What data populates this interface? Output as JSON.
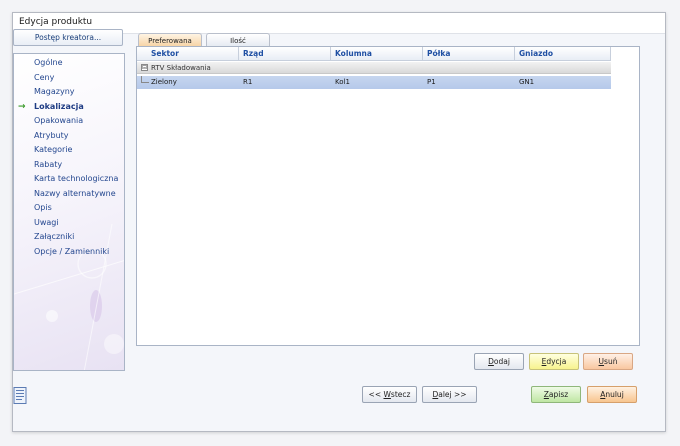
{
  "window": {
    "title": "Edycja produktu"
  },
  "wizard": {
    "progress_label": "Postęp kreatora..."
  },
  "nav": {
    "items": [
      {
        "label": "Ogólne",
        "active": false
      },
      {
        "label": "Ceny",
        "active": false
      },
      {
        "label": "Magazyny",
        "active": false
      },
      {
        "label": "Lokalizacja",
        "active": true
      },
      {
        "label": "Opakowania",
        "active": false
      },
      {
        "label": "Atrybuty",
        "active": false
      },
      {
        "label": "Kategorie",
        "active": false
      },
      {
        "label": "Rabaty",
        "active": false
      },
      {
        "label": "Karta technologiczna",
        "active": false
      },
      {
        "label": "Nazwy alternatywne",
        "active": false
      },
      {
        "label": "Opis",
        "active": false
      },
      {
        "label": "Uwagi",
        "active": false
      },
      {
        "label": "Załączniki",
        "active": false
      },
      {
        "label": "Opcje / Zamienniki",
        "active": false
      }
    ],
    "active_marker": "→"
  },
  "tabs": [
    {
      "label": "Preferowana"
    },
    {
      "label": "Ilość"
    }
  ],
  "grid": {
    "columns": [
      "Sektor",
      "Rząd",
      "Kolumna",
      "Półka",
      "Gniazdo"
    ],
    "groups": [
      {
        "label": "RTV Składowania",
        "toggle": "⊟",
        "rows": [
          [
            "Zielony",
            "R1",
            "Kol1",
            "P1",
            "GN1"
          ]
        ]
      }
    ]
  },
  "buttons": {
    "add": {
      "pre": "",
      "key": "D",
      "post": "odaj"
    },
    "edit": {
      "pre": "",
      "key": "E",
      "post": "dycja"
    },
    "delete": {
      "pre": "",
      "key": "U",
      "post": "suń"
    },
    "back": {
      "pre": "<< ",
      "key": "W",
      "post": "stecz"
    },
    "next": {
      "pre": "",
      "key": "D",
      "post": "alej >>"
    },
    "save": {
      "pre": "",
      "key": "Z",
      "post": "apisz"
    },
    "cancel": {
      "pre": "",
      "key": "A",
      "post": "nuluj"
    }
  },
  "colors": {
    "nav_text": "#24478f",
    "header_text": "#1f4fa3",
    "selected_row": "#b9ccec",
    "active_arrow": "#3a9a2a"
  },
  "icons": {
    "bottom_left": "document-icon"
  }
}
